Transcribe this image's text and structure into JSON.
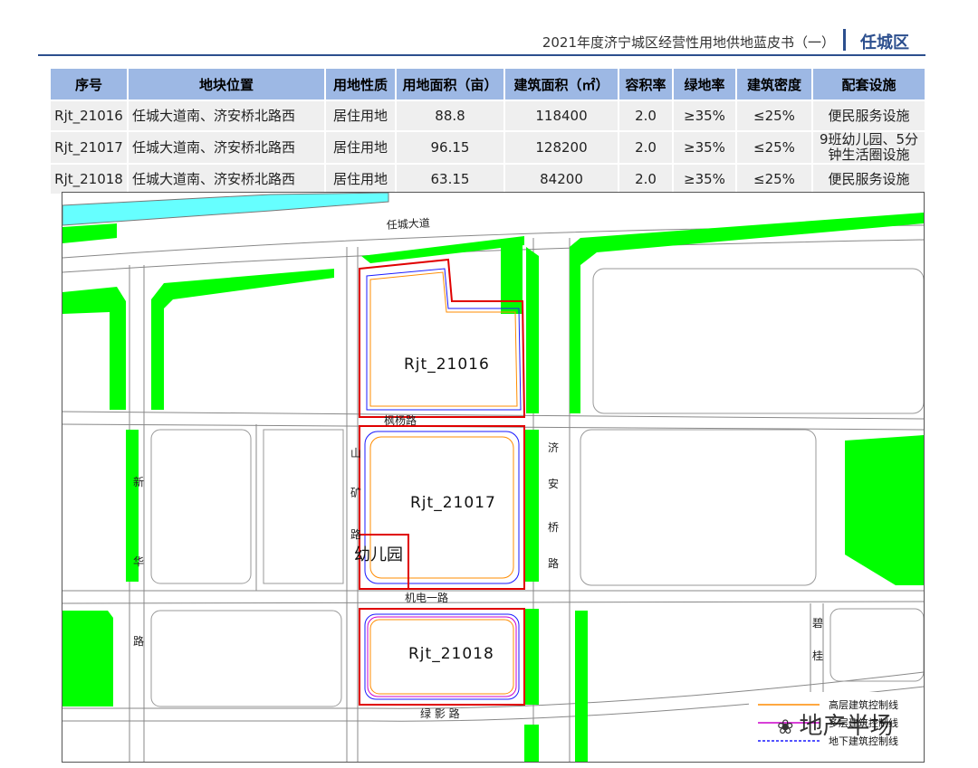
{
  "header": {
    "title": "2021年度济宁城区经营性用地供地蓝皮书（一）",
    "region": "任城区"
  },
  "table": {
    "columns": [
      "序号",
      "地块位置",
      "用地性质",
      "用地面积（亩）",
      "建筑面积（㎡）",
      "容积率",
      "绿地率",
      "建筑密度",
      "配套设施"
    ],
    "rows": [
      [
        "Rjt_21016",
        "任城大道南、济安桥北路西",
        "居住用地",
        "88.8",
        "118400",
        "2.0",
        "≥35%",
        "≤25%",
        "便民服务设施"
      ],
      [
        "Rjt_21017",
        "任城大道南、济安桥北路西",
        "居住用地",
        "96.15",
        "128200",
        "2.0",
        "≥35%",
        "≤25%",
        "9班幼儿园、5分钟生活圈设施"
      ],
      [
        "Rjt_21018",
        "任城大道南、济安桥北路西",
        "居住用地",
        "63.15",
        "84200",
        "2.0",
        "≥35%",
        "≤25%",
        "便民服务设施"
      ]
    ]
  },
  "map": {
    "roads": {
      "rencheng": "任城大道",
      "fengyang": "枫杨路",
      "jidian": "机电一路",
      "lvying": "绿 影 路",
      "shankuang": [
        "山",
        "矿",
        "路"
      ],
      "xinhua": [
        "新",
        "华",
        "路"
      ],
      "jianqiao": [
        "济",
        "安",
        "桥",
        "路"
      ],
      "bigui": [
        "碧",
        "桂"
      ]
    },
    "parcels": {
      "p21016": "Rjt_21016",
      "p21017": "Rjt_21017",
      "p21018": "Rjt_21018"
    },
    "kindergarten": "幼儿园",
    "legend": {
      "high": "高层建筑控制线",
      "low": "多层建筑控制线",
      "under": "地下建筑控制线"
    },
    "colors": {
      "green": "#00ff00",
      "water": "#66ffff",
      "parcel": "#e00000",
      "high": "#ff8c00",
      "low": "#cc00cc",
      "under": "#1a1aff"
    }
  },
  "watermark": "地产半场"
}
